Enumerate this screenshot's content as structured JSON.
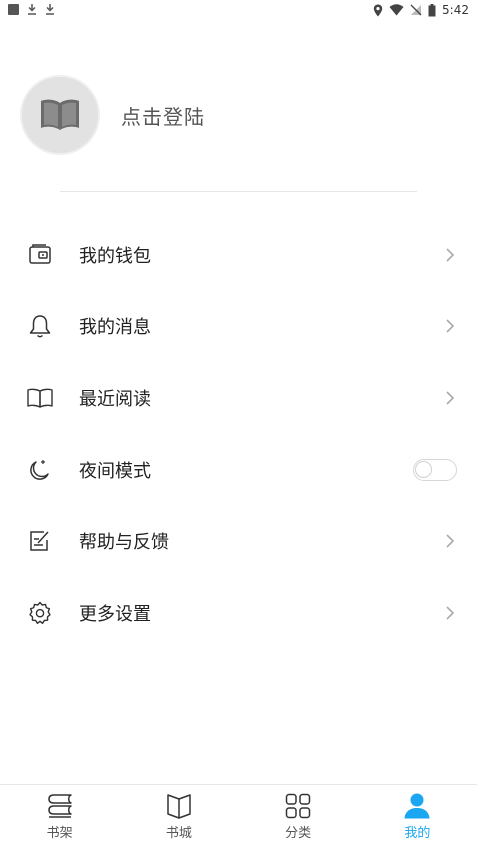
{
  "status_bar": {
    "time": "5:42",
    "left_icons": [
      "square-notification-icon",
      "download-icon",
      "download-icon"
    ],
    "right_icons": [
      "location-icon",
      "wifi-icon",
      "no-sim-icon",
      "battery-icon"
    ]
  },
  "profile": {
    "avatar_icon": "open-book-icon",
    "login_text": "点击登陆"
  },
  "menu": {
    "items": [
      {
        "label": "我的钱包",
        "icon": "wallet-icon",
        "control": "chevron"
      },
      {
        "label": "我的消息",
        "icon": "bell-icon",
        "control": "chevron"
      },
      {
        "label": "最近阅读",
        "icon": "book-icon",
        "control": "chevron"
      },
      {
        "label": "夜间模式",
        "icon": "moon-icon",
        "control": "toggle",
        "toggle_on": false
      },
      {
        "label": "帮助与反馈",
        "icon": "feedback-icon",
        "control": "chevron"
      },
      {
        "label": "更多设置",
        "icon": "gear-icon",
        "control": "chevron"
      }
    ]
  },
  "bottom_nav": {
    "items": [
      {
        "label": "书架",
        "icon": "bookshelf-icon",
        "active": false
      },
      {
        "label": "书城",
        "icon": "bookstore-icon",
        "active": false
      },
      {
        "label": "分类",
        "icon": "category-grid-icon",
        "active": false
      },
      {
        "label": "我的",
        "icon": "person-icon",
        "active": true
      }
    ]
  },
  "colors": {
    "accent": "#1aa6f0",
    "text": "#222222",
    "muted": "#555555",
    "divider": "#e6e6e6"
  }
}
